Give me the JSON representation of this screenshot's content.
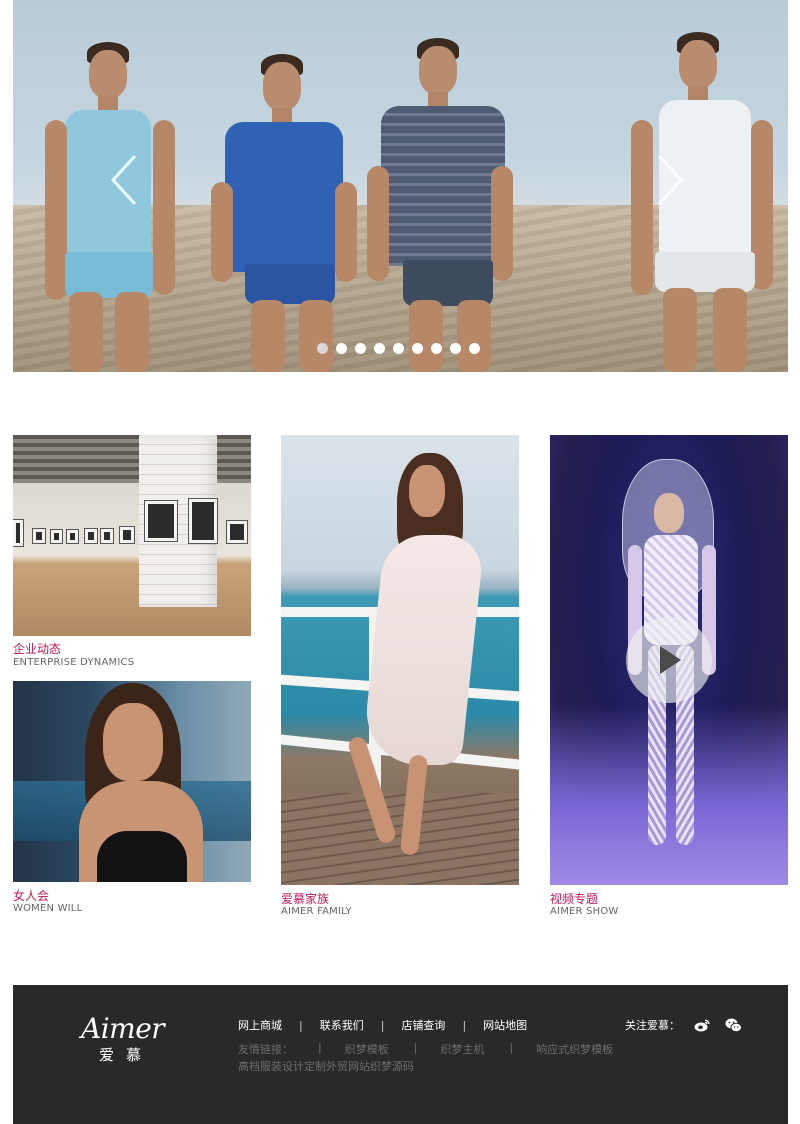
{
  "hero": {
    "prev_arrow": "chevron-left-icon",
    "next_arrow": "chevron-right-icon",
    "dot_count": 9,
    "active_dot": 0
  },
  "cards": [
    {
      "title": "企业动态",
      "subtitle": "ENTERPRISE DYNAMICS"
    },
    {
      "title": "女人会",
      "subtitle": "WOMEN WILL"
    },
    {
      "title": "爱慕家族",
      "subtitle": "AIMER FAMILY"
    },
    {
      "title": "视频专题",
      "subtitle": "AIMER SHOW"
    }
  ],
  "footer": {
    "logo_en": "Aimer",
    "logo_cn": "爱慕",
    "nav": [
      "网上商城",
      "联系我们",
      "店铺查询",
      "网站地图"
    ],
    "nav_separator": "|",
    "friends_label": "友情链接：",
    "friends": [
      "织梦模板",
      "织梦主机",
      "响应式织梦模板"
    ],
    "tagline": "高档服装设计定制外贸网站织梦源码",
    "follow_label": "关注爱慕：",
    "social_icons": [
      "weibo-icon",
      "wechat-icon"
    ],
    "text_color": "#6f6d6e",
    "background": "#2a2829"
  },
  "colors": {
    "accent": "#c2185b"
  }
}
